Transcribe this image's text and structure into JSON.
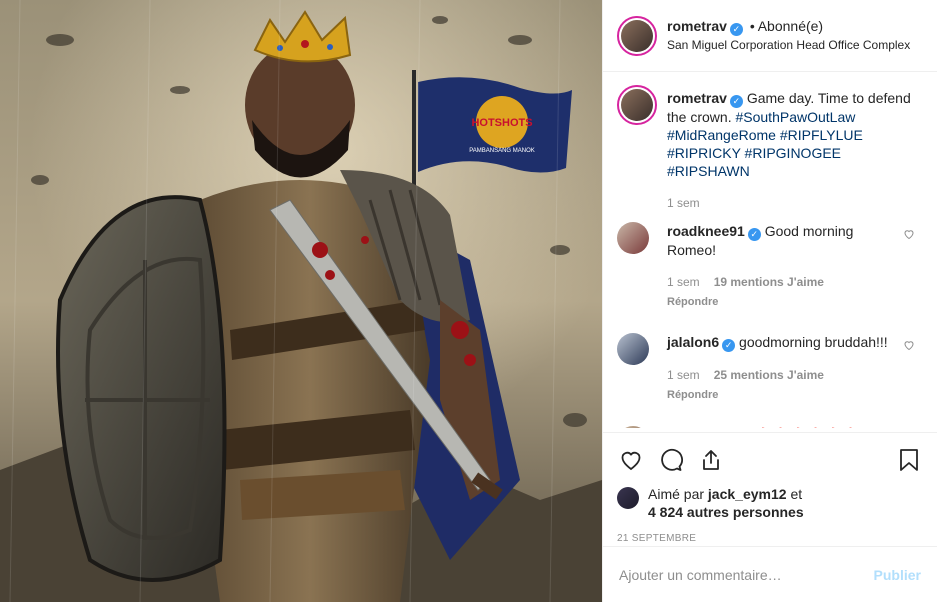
{
  "post": {
    "username": "rometrav",
    "verified_mark": "✓",
    "separator": "•",
    "follow_status": "Abonné(e)",
    "location": "San Miguel Corporation Head Office Complex",
    "image_flag_text": "HOTSHOTS",
    "image_flag_subtext": "PAMBANSANG MANOK"
  },
  "caption": {
    "username": "rometrav",
    "text": "Game day. Time to defend the crown.",
    "hashtags": "#SouthPawOutLaw #MidRangeRome #RIPFLYLUE #RIPRICKY #RIPGINOGEE #RIPSHAWN",
    "time": "1 sem"
  },
  "comments": [
    {
      "username": "roadknee91",
      "text": "Good morning Romeo!",
      "time": "1 sem",
      "likes": "19 mentions J'aime",
      "reply": "Répondre"
    },
    {
      "username": "jalalon6",
      "text": "goodmorning bruddah!!!",
      "time": "1 sem",
      "likes": "25 mentions J'aime",
      "reply": "Répondre"
    },
    {
      "username": "kingjames",
      "text": "🔥🔥🔥🔥🔥🔥"
    }
  ],
  "actions": {
    "liked_by_prefix": "Aimé par",
    "liked_by_user": "jack_eym12",
    "liked_by_and": "et",
    "others": "4 824 autres personnes",
    "date": "21 SEPTEMBRE"
  },
  "add_comment": {
    "placeholder": "Ajouter un commentaire…",
    "publish_label": "Publier"
  }
}
